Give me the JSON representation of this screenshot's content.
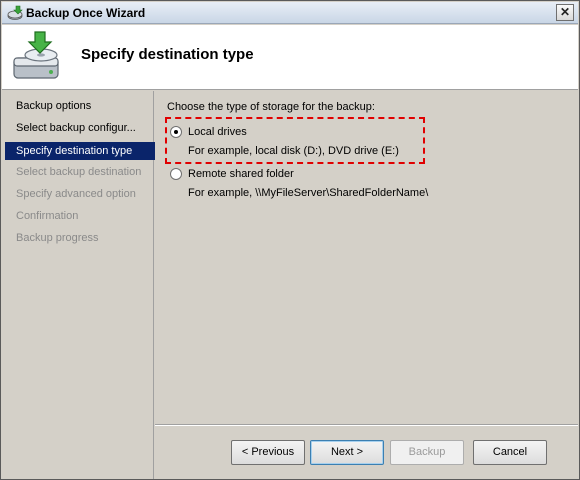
{
  "window": {
    "title": "Backup Once Wizard",
    "close_glyph": "✕"
  },
  "header": {
    "title": "Specify destination type"
  },
  "sidebar": {
    "items": [
      {
        "label": "Backup options",
        "state": "active"
      },
      {
        "label": "Select backup configur...",
        "state": "active"
      },
      {
        "label": "Specify destination type",
        "state": "selected"
      },
      {
        "label": "Select backup destination",
        "state": "disabled"
      },
      {
        "label": "Specify advanced option",
        "state": "disabled"
      },
      {
        "label": "Confirmation",
        "state": "disabled"
      },
      {
        "label": "Backup progress",
        "state": "disabled"
      }
    ]
  },
  "main": {
    "prompt": "Choose the type of storage for the backup:",
    "options": [
      {
        "label": "Local drives",
        "description": "For example, local disk (D:), DVD drive (E:)",
        "checked": true
      },
      {
        "label": "Remote shared folder",
        "description": "For example, \\\\MyFileServer\\SharedFolderName\\",
        "checked": false
      }
    ],
    "highlight_color": "#e00000"
  },
  "buttons": {
    "previous": "< Previous",
    "next": "Next >",
    "backup": "Backup",
    "cancel": "Cancel"
  },
  "colors": {
    "selected_bg": "#0a246a",
    "dialog_bg": "#d4d0c8"
  }
}
